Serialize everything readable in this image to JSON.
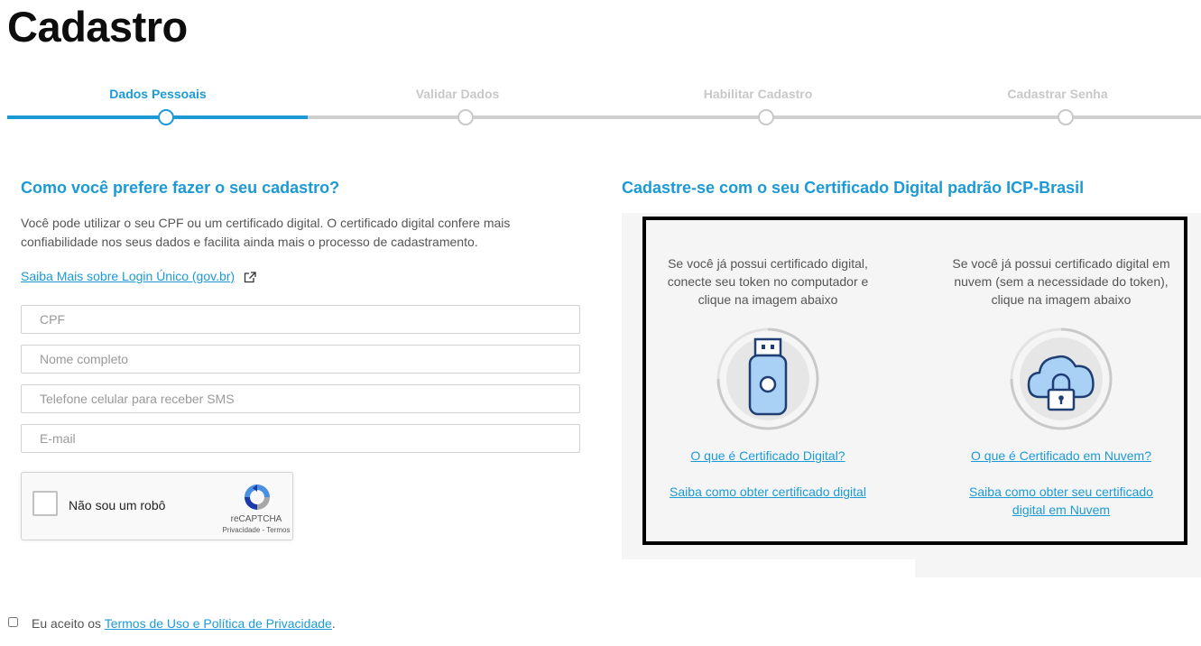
{
  "page": {
    "title": "Cadastro"
  },
  "steps": [
    {
      "label": "Dados Pessoais",
      "active": true
    },
    {
      "label": "Validar Dados",
      "active": false
    },
    {
      "label": "Habilitar Cadastro",
      "active": false
    },
    {
      "label": "Cadastrar Senha",
      "active": false
    }
  ],
  "left": {
    "heading": "Como você prefere fazer o seu cadastro?",
    "description": "Você pode utilizar o seu CPF ou um certificado digital. O certificado digital confere mais confiabilidade nos seus dados e facilita ainda mais o processo de cadastramento.",
    "learn_more": "Saiba Mais sobre Login Único (gov.br)",
    "fields": {
      "cpf": "CPF",
      "name": "Nome completo",
      "phone": "Telefone celular para receber SMS",
      "email": "E-mail"
    }
  },
  "recaptcha": {
    "label": "Não sou um robô",
    "brand": "reCAPTCHA",
    "links": "Privacidade - Termos"
  },
  "right": {
    "heading": "Cadastre-se com o seu Certificado Digital padrão ICP-Brasil",
    "token": {
      "text": "Se você já possui certificado digital, conecte seu token no computador e clique na imagem abaixo",
      "link_what": "O que é Certificado Digital?",
      "link_how": "Saiba como obter certificado digital"
    },
    "cloud": {
      "text": "Se você já possui certificado digital em nuvem (sem a necessidade do token), clique na imagem abaixo",
      "link_what": "O que é Certificado em Nuvem?",
      "link_how": "Saiba como obter seu certificado digital em Nuvem"
    }
  },
  "terms": {
    "prefix": "Eu aceito os ",
    "link": "Termos de Uso e Política de Privacidade",
    "suffix": "."
  },
  "colors": {
    "accent": "#1c9ad6",
    "inactive": "#c8c8c8",
    "heading": "#0d0d0d"
  }
}
